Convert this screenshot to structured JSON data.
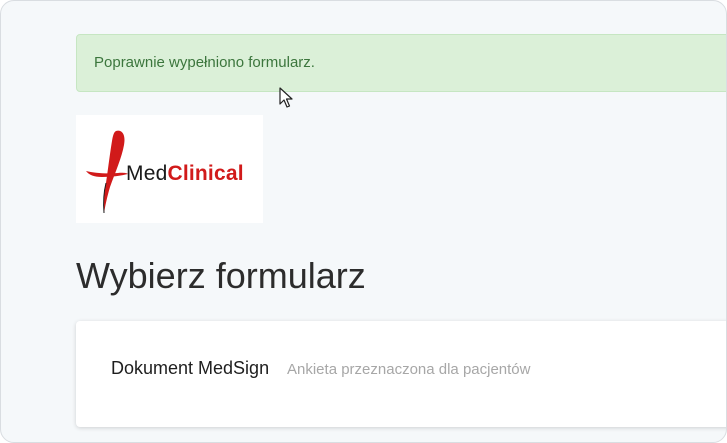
{
  "alert": {
    "message": "Poprawnie wypełniono formularz.",
    "color": "#3c763d",
    "background": "#dbf0d8"
  },
  "logo": {
    "name_part1": "Med",
    "name_part2": "Clinical",
    "accent_color": "#d11a1a",
    "icon": "medclinical-logo-icon"
  },
  "page": {
    "title": "Wybierz formularz"
  },
  "forms": [
    {
      "name": "Dokument MedSign",
      "description": "Ankieta przeznaczona dla pacjentów"
    }
  ],
  "cursor": {
    "icon": "mouse-pointer-icon"
  }
}
